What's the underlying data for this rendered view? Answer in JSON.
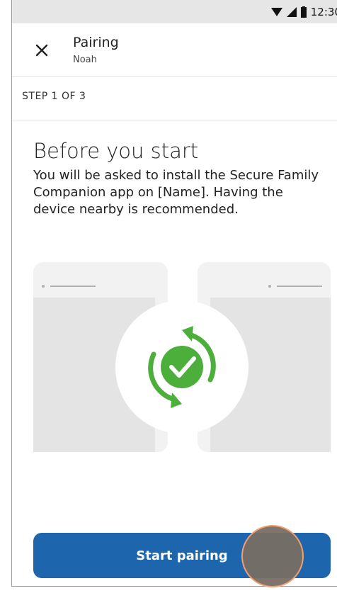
{
  "status_bar": {
    "time": "12:30",
    "icons": [
      "wifi-icon",
      "signal-icon",
      "battery-icon"
    ]
  },
  "header": {
    "title": "Pairing",
    "subtitle": "Noah",
    "close_icon": "close-icon"
  },
  "step_label": "STEP 1 OF 3",
  "main": {
    "heading": "Before you start",
    "body": "You will be asked to install the Secure Family Companion app on [Name]. Having the device nearby is recommended."
  },
  "illustration": {
    "icon": "sync-check-icon",
    "accent_color": "#4caf3c"
  },
  "primary_button": {
    "label": "Start pairing",
    "color": "#1d66ad"
  }
}
